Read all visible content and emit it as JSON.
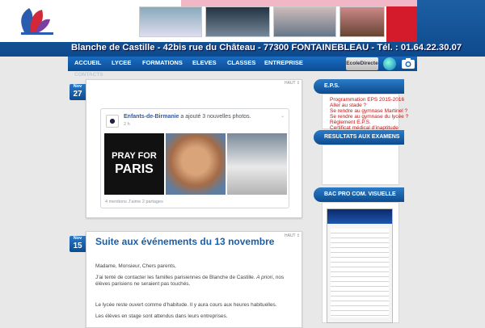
{
  "header": {
    "address": "Blanche de Castille - 42bis rue du Château - 77300 FONTAINEBLEAU - Tél. : 01.64.22.30.07"
  },
  "nav": {
    "items": [
      "ACCUEIL",
      "LYCEE",
      "FORMATIONS",
      "ELEVES",
      "CLASSES",
      "ENTREPRISE"
    ],
    "contacts": "CONTACTS",
    "ecole_directe": "EcoleDirecte"
  },
  "post1": {
    "month": "Nov",
    "day": "27",
    "haut": "HAUT ↥",
    "fb_page": "Enfants-de-Birmanie",
    "fb_action": "a ajouté 3 nouvelles photos.",
    "fb_time": "2 h",
    "fb_stats": "4 mentions J’aime   2 partages",
    "photo_text_1": "PRAY FOR",
    "photo_text_2": "PARIS"
  },
  "post2": {
    "month": "Nov",
    "day": "15",
    "haut": "HAUT ↥",
    "title": "Suite aux événements du 13 novembre",
    "p1": "Madame, Monsieur, Chers parents,",
    "p2a": "J’ai tenté de contacter les familles parisiennes de Blanche de Castille.",
    "p2b": "A priori",
    "p2c": ", nos",
    "p2d": "élèves parisiens ne seraient pas touchés.",
    "p3": "Le lycée reste ouvert comme d’habitude. Il y aura cours aux heures habituelles.",
    "p4": "Les élèves en stage sont attendus dans leurs entreprises."
  },
  "sidebar": {
    "eps_title": "E.P.S.",
    "eps_links": [
      "Programmation EPS 2015-2016",
      "Aller au stade ?",
      "Se rendre au gymnase Martinel ?",
      "Se rendre au gymnase du lycée ?",
      "Règlement E.P.S.",
      "Certificat médical d’inaptitude"
    ],
    "results_title": "RESULTATS AUX EXAMENS",
    "bac_title": "BAC PRO COM. VISUELLE"
  }
}
